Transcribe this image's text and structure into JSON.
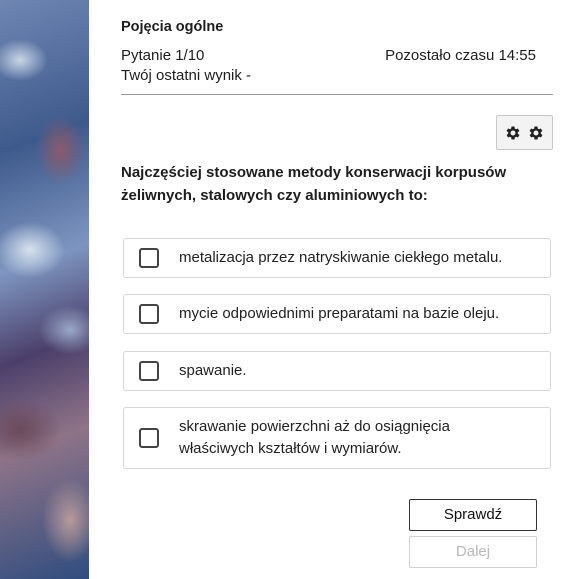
{
  "header": {
    "section_title": "Pojęcia ogólne",
    "question_counter": "Pytanie 1/10",
    "time_left": "Pozostało czasu 14:55",
    "last_score": "Twój ostatni wynik -"
  },
  "toolbar": {
    "icons": [
      "gear-icon",
      "gear-icon"
    ]
  },
  "question": {
    "text": "Najczęściej stosowane metody konserwacji korpusów żeliwnych, stalowych czy aluminiowych to:"
  },
  "answers": [
    {
      "label": "metalizacja przez natryskiwanie ciekłego metalu.",
      "checked": false
    },
    {
      "label": "mycie odpowiednimi preparatami na bazie oleju.",
      "checked": false
    },
    {
      "label": "spawanie.",
      "checked": false
    },
    {
      "label": "skrawanie powierzchni aż do osiągnięcia właściwych kształtów i wymiarów.",
      "checked": false
    }
  ],
  "buttons": {
    "check_label": "Sprawdź",
    "next_label": "Dalej",
    "next_enabled": false
  }
}
